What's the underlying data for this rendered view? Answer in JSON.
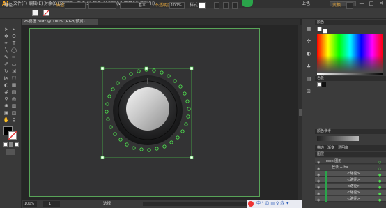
{
  "app": {
    "logo": "Ai",
    "menus": [
      "文件(F)",
      "编辑(E)",
      "对象(O)",
      "文字(T)",
      "选择(S)",
      "效果(C)",
      "视图(V)",
      "窗口(W)",
      "帮助(H)"
    ],
    "workspace": "上色",
    "window_buttons": [
      "—",
      "□",
      "✕"
    ]
  },
  "control_bar": {
    "object_label": "路径",
    "stroke_label": "描边",
    "stroke_style": "基本",
    "opacity_label": "不透明度",
    "opacity_value": "100%",
    "style_label": "样式",
    "transform_label": "变换"
  },
  "document": {
    "tab_title": "PS旋钮.psd* @ 100% (RGB/预览)"
  },
  "status_bar": {
    "zoom": "100%",
    "page": "1",
    "mode": "选择"
  },
  "panels": {
    "color_title": "颜色",
    "swatches_title": "色板",
    "color_guide_title": "颜色参考",
    "appearance_tabs": [
      "描边",
      "渐变",
      "透明度"
    ],
    "layers_title": "图层",
    "layers": [
      {
        "name": "rock 图形"
      },
      {
        "name": "登录 + ba"
      },
      {
        "name": "<路径>"
      },
      {
        "name": "<路径>"
      },
      {
        "name": "<路径>"
      },
      {
        "name": "<路径>"
      },
      {
        "name": "<路径>"
      }
    ]
  },
  "colors": {
    "accent_green": "#2aa44a",
    "selection_green": "#4fe04f",
    "artboard_border": "#58a458",
    "orange_label": "#e5a73c"
  }
}
